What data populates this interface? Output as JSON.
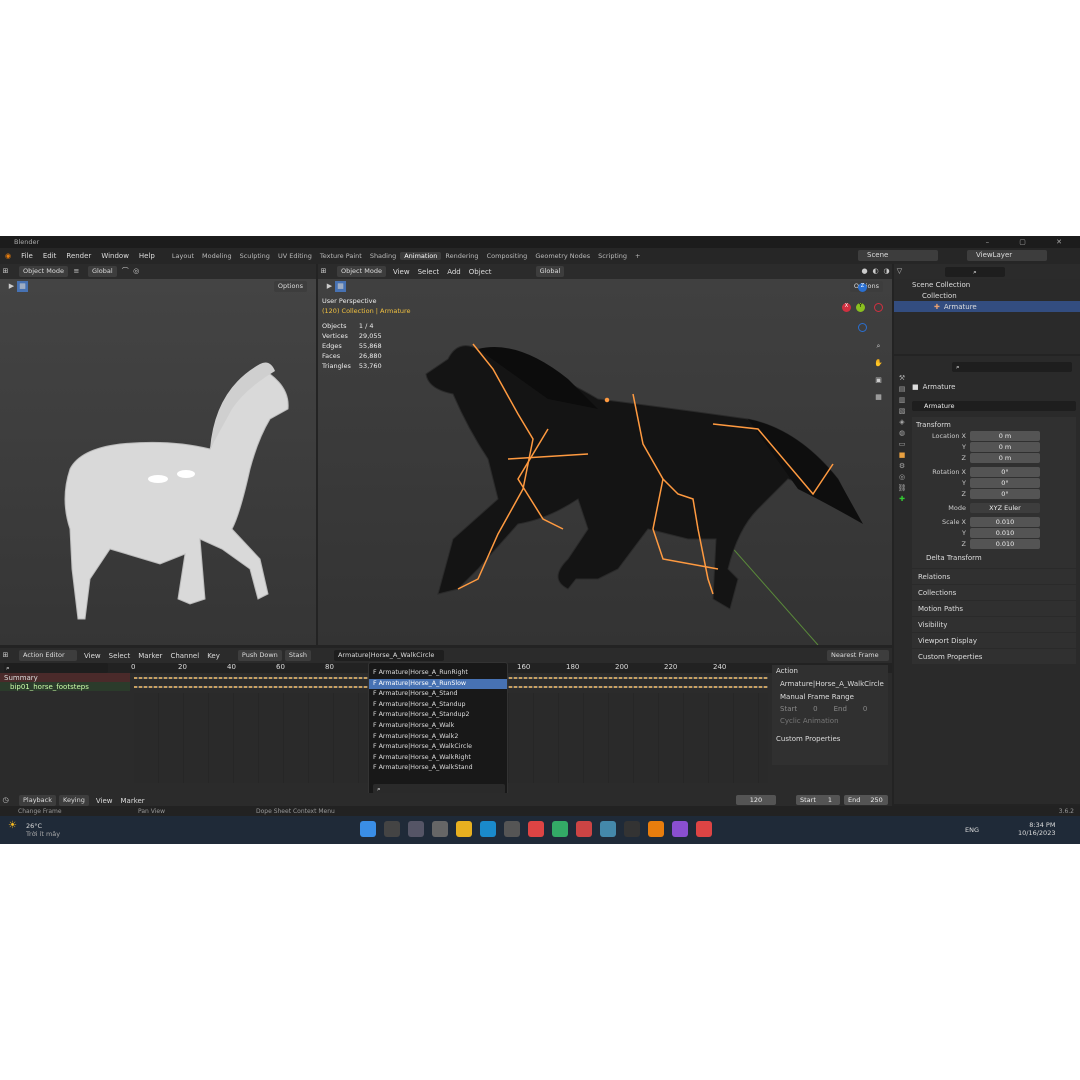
{
  "app": {
    "title": "Blender",
    "version": "3.6.2"
  },
  "menu": [
    "File",
    "Edit",
    "Render",
    "Window",
    "Help"
  ],
  "workspaces": [
    "Layout",
    "Modeling",
    "Sculpting",
    "UV Editing",
    "Texture Paint",
    "Shading",
    "Animation",
    "Rendering",
    "Compositing",
    "Geometry Nodes",
    "Scripting"
  ],
  "active_workspace": "Animation",
  "scene": {
    "label": "Scene",
    "view_layer": "ViewLayer"
  },
  "left_view": {
    "mode": "Object Mode",
    "orientation": "Global",
    "options": "Options"
  },
  "main_view": {
    "mode": "Object Mode",
    "menus": [
      "View",
      "Select",
      "Add",
      "Object"
    ],
    "orientation": "Global",
    "options": "Options",
    "title": "User Perspective",
    "subtitle": "(120) Collection | Armature",
    "stats": [
      [
        "Objects",
        "1 / 4"
      ],
      [
        "Vertices",
        "29,055"
      ],
      [
        "Edges",
        "55,868"
      ],
      [
        "Faces",
        "26,880"
      ],
      [
        "Triangles",
        "53,760"
      ]
    ]
  },
  "outliner": {
    "items": [
      "Scene Collection",
      "Collection",
      "Armature"
    ]
  },
  "properties": {
    "object": "Armature",
    "data": "Armature",
    "transform": "Transform",
    "location": [
      [
        "Location X",
        "0 m"
      ],
      [
        "Y",
        "0 m"
      ],
      [
        "Z",
        "0 m"
      ]
    ],
    "rotation": [
      [
        "Rotation X",
        "0°"
      ],
      [
        "Y",
        "0°"
      ],
      [
        "Z",
        "0°"
      ]
    ],
    "mode_label": "Mode",
    "mode": "XYZ Euler",
    "scale": [
      [
        "Scale X",
        "0.010"
      ],
      [
        "Y",
        "0.010"
      ],
      [
        "Z",
        "0.010"
      ]
    ],
    "sections": [
      "Delta Transform",
      "Relations",
      "Collections",
      "Motion Paths",
      "Visibility",
      "Viewport Display",
      "Custom Properties"
    ]
  },
  "action_editor": {
    "mode": "Action Editor",
    "menus": [
      "View",
      "Select",
      "Marker",
      "Channel",
      "Key"
    ],
    "push_down": "Push Down",
    "stash": "Stash",
    "action": "Armature|Horse_A_WalkCircle",
    "snap": "Nearest Frame",
    "ruler": [
      "0",
      "20",
      "40",
      "60",
      "80",
      "160",
      "180",
      "200",
      "220",
      "240"
    ],
    "channels": [
      "Summary",
      "bip01_horse_footsteps"
    ],
    "side": {
      "header": "Action",
      "action": "Armature|Horse_A_WalkCircle",
      "manual": "Manual Frame Range",
      "start": "Start",
      "start_v": "0",
      "end": "End",
      "end_v": "0",
      "cyclic": "Cyclic Animation",
      "custom": "Custom Properties"
    },
    "dropdown": [
      "F Armature|Horse_A_RunRight",
      "F Armature|Horse_A_RunSlow",
      "F Armature|Horse_A_Stand",
      "F Armature|Horse_A_Standup",
      "F Armature|Horse_A_Standup2",
      "F Armature|Horse_A_Walk",
      "F Armature|Horse_A_Walk2",
      "F Armature|Horse_A_WalkCircle",
      "F Armature|Horse_A_WalkRight",
      "F Armature|Horse_A_WalkStand"
    ],
    "dropdown_selected": 1
  },
  "timeline": {
    "menus": [
      "Playback",
      "Keying",
      "View",
      "Marker"
    ],
    "frame": "120",
    "start_label": "Start",
    "start": "1",
    "end_label": "End",
    "end": "250"
  },
  "statusbar": [
    "Change Frame",
    "Pan View",
    "Dope Sheet Context Menu"
  ],
  "taskbar": {
    "temp": "26°C",
    "weather": "Trời ít mây",
    "lang": "ENG",
    "time": "8:34 PM",
    "date": "10/16/2023"
  }
}
